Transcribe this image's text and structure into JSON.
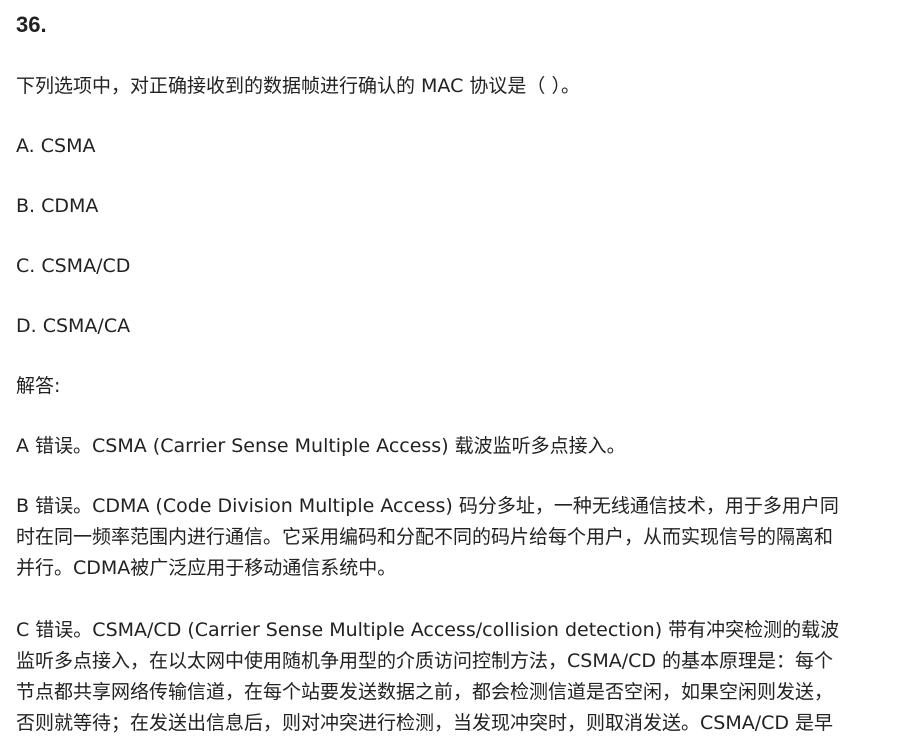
{
  "question": {
    "number": "36.",
    "stem": "下列选项中，对正确接收到的数据帧进行确认的 MAC 协议是（ ）。",
    "options": [
      "A. CSMA",
      "B. CDMA",
      "C. CSMA/CD",
      "D. CSMA/CA"
    ]
  },
  "answer": {
    "heading": "解答:",
    "a": "A 错误。CSMA (Carrier Sense Multiple Access) 载波监听多点接入。",
    "b_lines": [
      "B 错误。CDMA (Code Division Multiple Access) 码分多址，一种无线通信技术，用于多用户同",
      "时在同一频率范围内进行通信。它采用编码和分配不同的码片给每个用户，从而实现信号的隔离和",
      "并行。CDMA被广泛应用于移动通信系统中。"
    ],
    "c_lines": [
      "C 错误。CSMA/CD (Carrier Sense Multiple Access/collision detection) 带有冲突检测的载波",
      "监听多点接入，在以太网中使用随机争用型的介质访问控制方法，CSMA/CD 的基本原理是：每个",
      "节点都共享网络传输信道，在每个站要发送数据之前，都会检测信道是否空闲，如果空闲则发送，",
      "否则就等待；在发送出信息后，则对冲突进行检测，当发现冲突时，则取消发送。CSMA/CD 是早"
    ]
  }
}
